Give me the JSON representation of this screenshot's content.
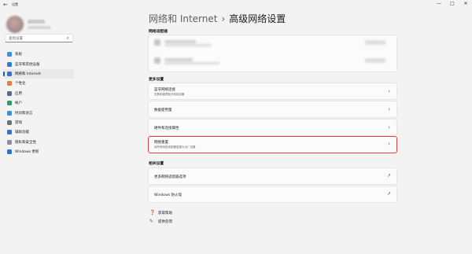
{
  "window": {
    "app_title": "设置",
    "controls": {
      "min": "—",
      "max": "□",
      "close": "✕"
    },
    "back_glyph": "←"
  },
  "sidebar": {
    "search_placeholder": "查找设置",
    "items": [
      {
        "label": "系统",
        "icon": "system-icon",
        "color": "#3a8ee6"
      },
      {
        "label": "蓝牙和其他设备",
        "icon": "bluetooth-icon",
        "color": "#2b7bd4"
      },
      {
        "label": "网络和 Internet",
        "icon": "wifi-icon",
        "color": "#3b6fd1",
        "active": true
      },
      {
        "label": "个性化",
        "icon": "brush-icon",
        "color": "#e0803a"
      },
      {
        "label": "应用",
        "icon": "apps-icon",
        "color": "#5a6a80"
      },
      {
        "label": "帐户",
        "icon": "account-icon",
        "color": "#2f9b6a"
      },
      {
        "label": "时间和语言",
        "icon": "globe-icon",
        "color": "#3a8ee6"
      },
      {
        "label": "游戏",
        "icon": "gamepad-icon",
        "color": "#6b7280"
      },
      {
        "label": "辅助功能",
        "icon": "accessibility-icon",
        "color": "#3a6fd1"
      },
      {
        "label": "隐私和安全性",
        "icon": "shield-icon",
        "color": "#8a8f99"
      },
      {
        "label": "Windows 更新",
        "icon": "update-icon",
        "color": "#1f7ad0"
      }
    ]
  },
  "header": {
    "parent": "网络和 Internet",
    "separator": "›",
    "current": "高级网络设置"
  },
  "sections": {
    "adapters_title": "网络适配器",
    "more_title": "更多设置",
    "related_title": "相关设置"
  },
  "more_settings": [
    {
      "title": "蓝牙网络连接",
      "subtitle": "查看和管理蓝牙网络设备"
    },
    {
      "title": "数据使用量",
      "subtitle": ""
    },
    {
      "title": "硬件和连接属性",
      "subtitle": ""
    },
    {
      "title": "网络重置",
      "subtitle": "将所有网络适配器重置为出厂设置"
    }
  ],
  "related_settings": [
    {
      "title": "更多网络适配器选项"
    },
    {
      "title": "Windows 防火墙"
    }
  ],
  "footer_links": [
    {
      "label": "获取帮助",
      "icon": "help-icon"
    },
    {
      "label": "提供反馈",
      "icon": "feedback-icon"
    }
  ],
  "glyphs": {
    "chevron": "›",
    "external": "↗",
    "search": "⌕"
  },
  "accent_color": "#0067c0",
  "highlight_color": "#e04141"
}
